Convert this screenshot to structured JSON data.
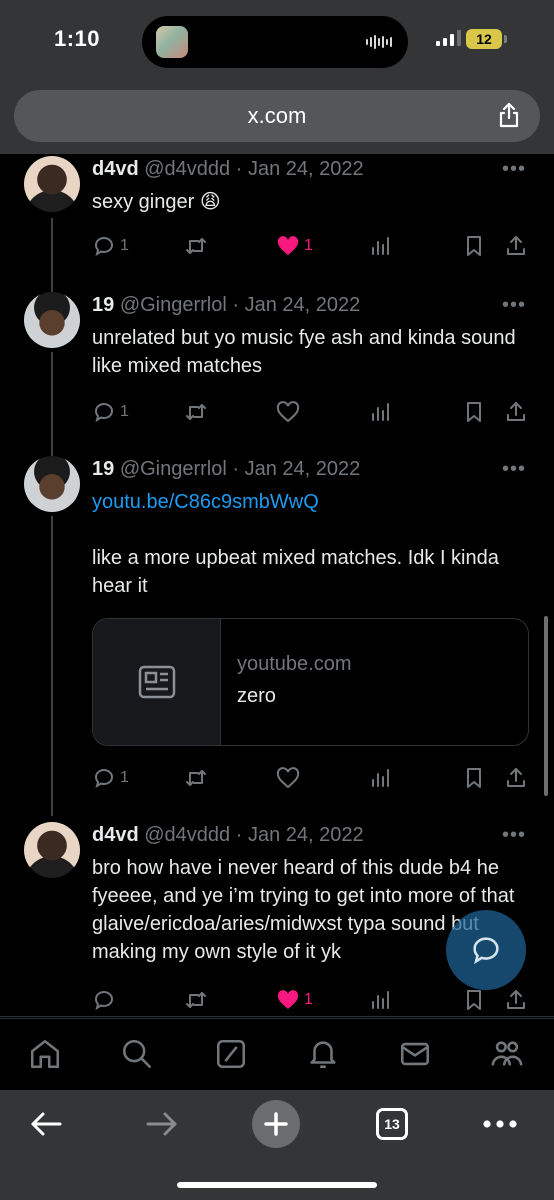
{
  "status_bar": {
    "time": "1:10",
    "battery": "12",
    "accent_battery": "#d9c74a"
  },
  "browser": {
    "url": "x.com",
    "tab_count": "13",
    "icons": [
      "share-icon",
      "back-arrow-icon",
      "forward-arrow-icon",
      "plus-icon",
      "tabs-icon",
      "more-icon"
    ]
  },
  "tweets": [
    {
      "name": "d4vd",
      "meta": "@d4vddd · Jan 24, 2022",
      "text": "sexy ginger 😩",
      "replies": "1",
      "likes": "1",
      "liked": true
    },
    {
      "name": "19",
      "meta": "@Gingerrlol · Jan 24, 2022",
      "text": "unrelated but yo music fye ash and kinda sound like mixed matches",
      "replies": "1",
      "likes": "",
      "liked": false
    },
    {
      "name": "19",
      "meta": "@Gingerrlol · Jan 24, 2022",
      "link": "youtu.be/C86c9smbWwQ",
      "text": "like a more upbeat mixed matches. Idk I kinda hear it",
      "card": {
        "domain": "youtube.com",
        "title": "zero"
      },
      "replies": "1",
      "likes": "",
      "liked": false
    },
    {
      "name": "d4vd",
      "meta": "@d4vddd · Jan 24, 2022",
      "text": "bro how have i never heard of this dude b4 he fyeeee, and ye i’m trying to get into more of that glaive/ericdoa/aries/midwxst typa sound but making my own style of it yk",
      "replies": "",
      "likes": "1",
      "liked": true
    }
  ],
  "colors": {
    "like": "#f91880",
    "link": "#1d9bf0",
    "muted": "#71767b",
    "background": "#000000"
  },
  "x_nav": [
    "home-icon",
    "search-icon",
    "grok-icon",
    "notifications-icon",
    "messages-icon",
    "communities-icon"
  ]
}
